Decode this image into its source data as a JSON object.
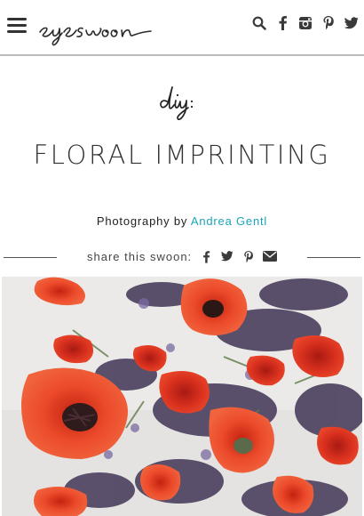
{
  "header": {
    "logo_text": "eyeswoon",
    "menu_icon": "hamburger-icon",
    "social_icons": [
      "search-icon",
      "facebook-icon",
      "instagram-icon",
      "pinterest-icon",
      "twitter-icon"
    ]
  },
  "article": {
    "category_script": "diy:",
    "title": "FLORAL IMPRINTING",
    "credit_prefix": "Photography by",
    "credit_name": "Andrea Gentl"
  },
  "share": {
    "label": "share this swoon:",
    "icons": [
      "facebook-icon",
      "twitter-icon",
      "pinterest-icon",
      "email-icon"
    ]
  },
  "colors": {
    "link": "#1aa5b8",
    "rule": "#bcbcbc",
    "poppy": "#e8432a"
  },
  "photo": {
    "subject": "pressed poppies and dried flowers on linen"
  }
}
